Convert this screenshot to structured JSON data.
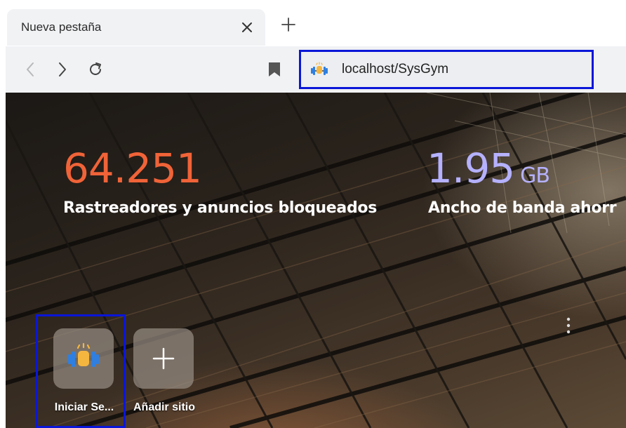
{
  "tabs": [
    {
      "title": "Nueva pestaña",
      "active": true
    }
  ],
  "toolbar": {
    "back_icon": "chevron-left-icon",
    "forward_icon": "chevron-right-icon",
    "reload_icon": "reload-icon",
    "bookmark_icon": "bookmark-icon",
    "url": "localhost/SysGym"
  },
  "stats": [
    {
      "value": "64.251",
      "unit": "",
      "label": "Rastreadores y anuncios bloqueados",
      "color": "#f06338"
    },
    {
      "value": "1.95",
      "unit": "GB",
      "label": "Ancho de banda ahorr",
      "color": "#b5b1ff"
    }
  ],
  "shortcuts": [
    {
      "label": "Iniciar Se...",
      "icon": "gym-dumbbell-icon"
    },
    {
      "label": "Añadir sitio",
      "icon": "plus-icon"
    }
  ],
  "colors": {
    "highlight": "#0a16d8",
    "toolbar_bg": "#f1f2f4"
  }
}
